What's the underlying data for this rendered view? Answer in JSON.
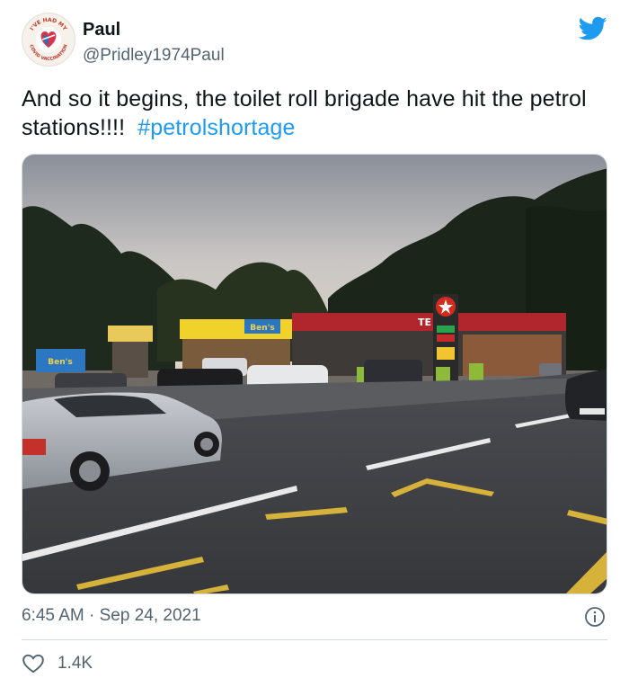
{
  "author": {
    "name": "Paul",
    "handle": "@Pridley1974Paul",
    "avatar_icon": "heart-badge-avatar",
    "avatar_text_top": "I'VE HAD MY",
    "avatar_text_bottom": "COVID VACCINATION"
  },
  "tweet": {
    "text": "And so it begins, the toilet roll brigade have hit the petrol stations!!!!",
    "hashtag": "#petrolshortage"
  },
  "photo": {
    "sign_texaco": "TE",
    "sign_bens_1": "Ben's",
    "sign_bens_2": "Ben's"
  },
  "meta": {
    "time": "6:45 AM",
    "separator": "·",
    "date": "Sep 24, 2021"
  },
  "actions": {
    "like_count": "1.4K"
  },
  "colors": {
    "text": "#0f1419",
    "secondary": "#536471",
    "link": "#1d9bf0",
    "twitter_blue": "#1d9bf0",
    "divider": "#cfd9de"
  },
  "icons": {
    "brand": "twitter-bird-icon",
    "info": "info-icon",
    "like": "heart-icon"
  }
}
